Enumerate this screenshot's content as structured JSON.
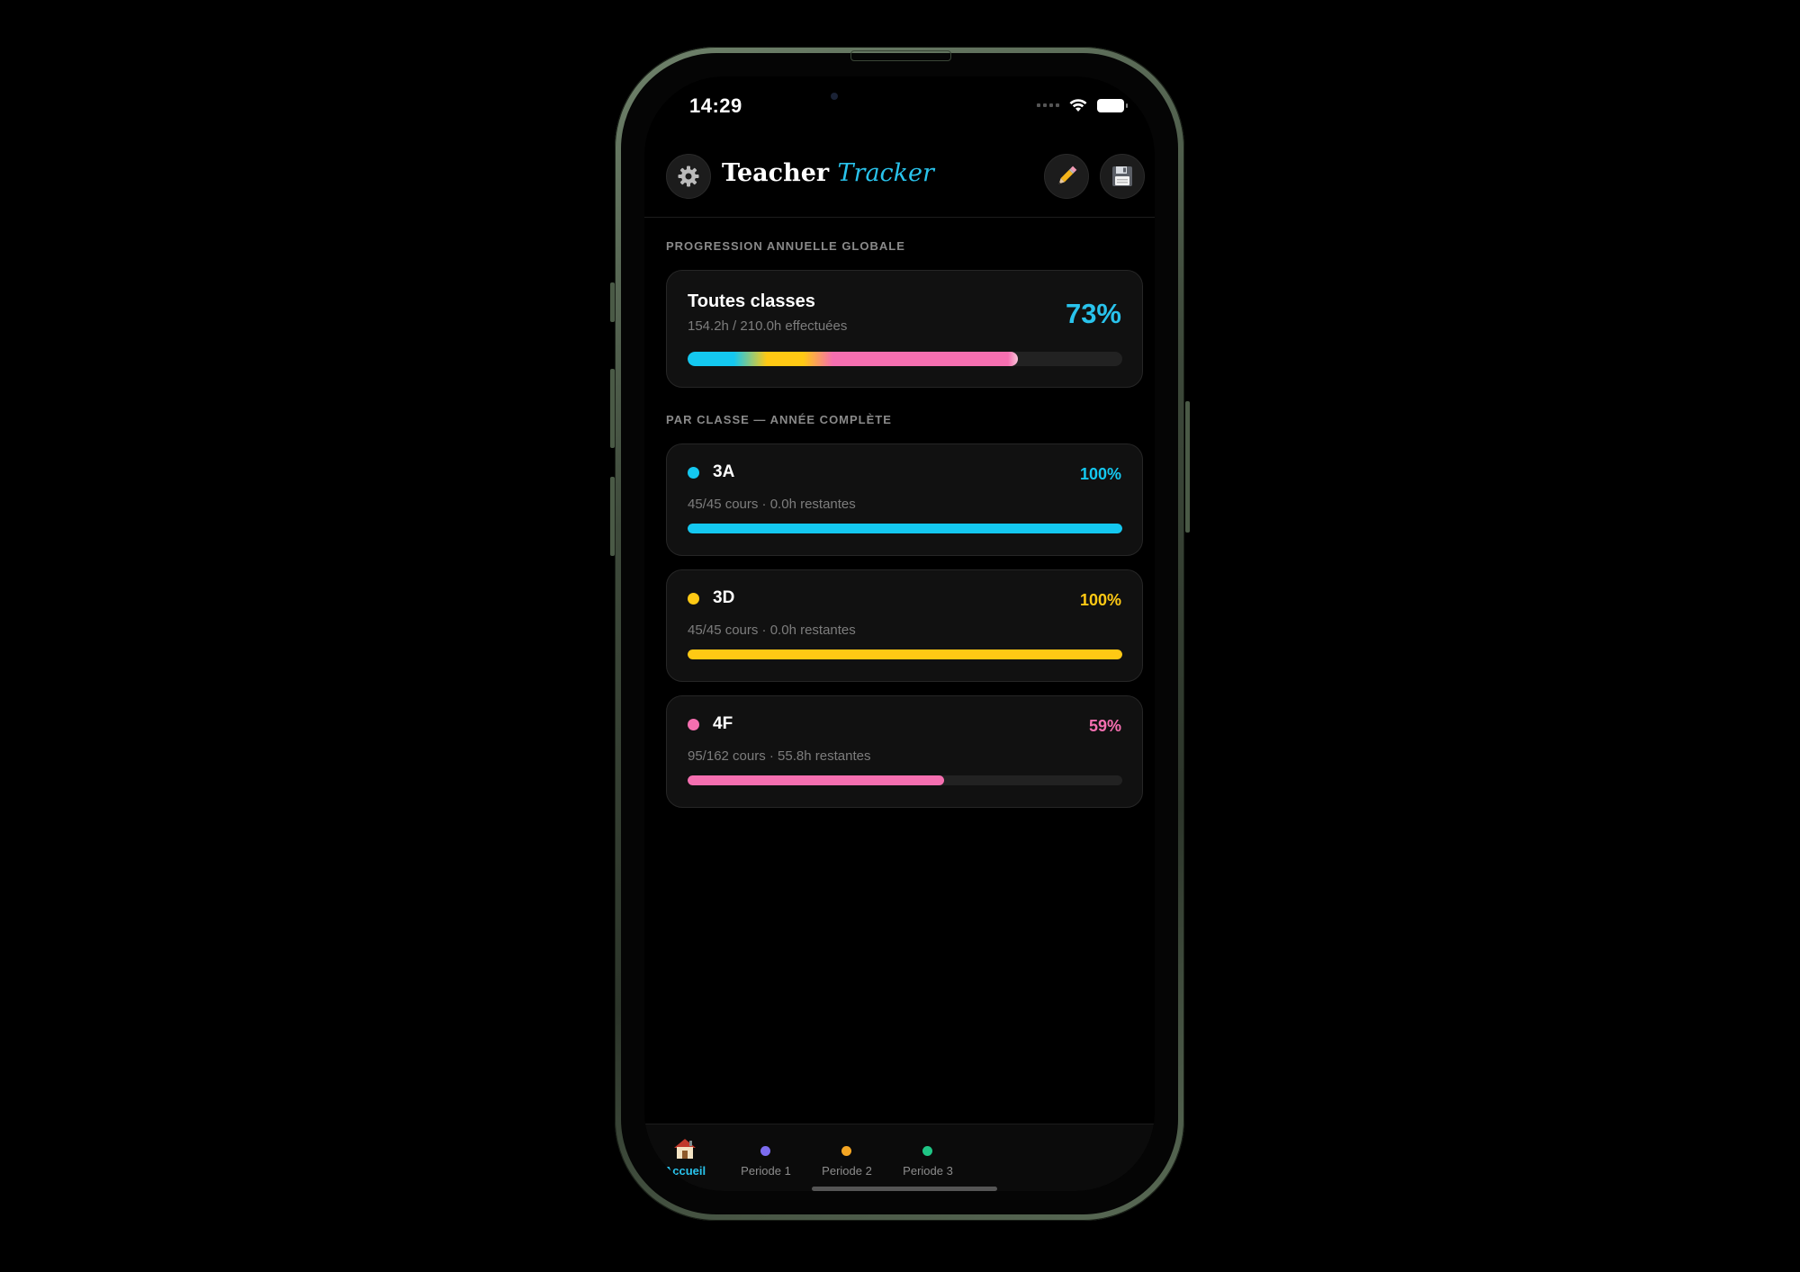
{
  "status_bar": {
    "time": "14:29"
  },
  "header": {
    "title_main": "Teacher",
    "title_accent": "Tracker",
    "settings_icon": "gear-icon",
    "edit_icon": "pencil-icon",
    "save_icon": "floppy-disk-icon"
  },
  "global": {
    "section_label": "PROGRESSION ANNUELLE GLOBALE",
    "title": "Toutes classes",
    "subtitle": "154.2h / 210.0h effectuées",
    "percent_label": "73%",
    "progress": 0.76,
    "accent_color": "#29c3ec"
  },
  "classes_section_label": "PAR CLASSE — ANNÉE COMPLÈTE",
  "classes": [
    {
      "name": "3A",
      "details": "45/45 cours · 0.0h restantes",
      "percent_label": "100%",
      "progress": 1.0,
      "color": "#14c8f0"
    },
    {
      "name": "3D",
      "details": "45/45 cours · 0.0h restantes",
      "percent_label": "100%",
      "progress": 1.0,
      "color": "#ffc914"
    },
    {
      "name": "4F",
      "details": "95/162 cours · 55.8h restantes",
      "percent_label": "59%",
      "progress": 0.59,
      "color": "#f56fb0"
    }
  ],
  "tabs": [
    {
      "label": "Accueil",
      "icon": "house-icon",
      "active": true
    },
    {
      "label": "Periode 1",
      "dot_color": "#7c6cf0",
      "active": false
    },
    {
      "label": "Periode 2",
      "dot_color": "#f5a623",
      "active": false
    },
    {
      "label": "Periode 3",
      "dot_color": "#1fc585",
      "active": false
    }
  ]
}
